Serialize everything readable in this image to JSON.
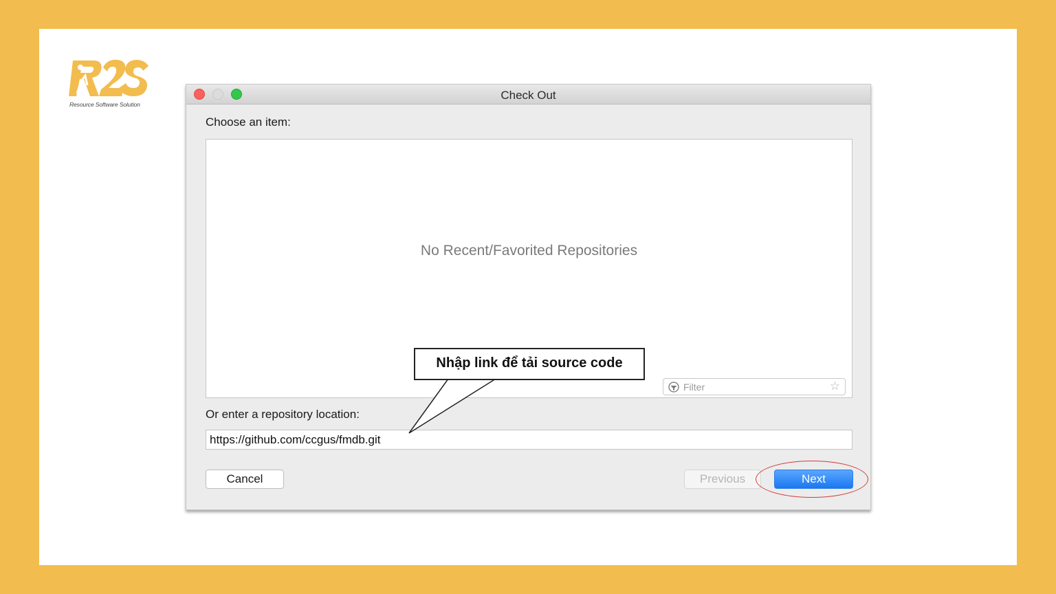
{
  "logo": {
    "tagline": "Resource Software Solution"
  },
  "window": {
    "title": "Check Out",
    "choose_label": "Choose an item:",
    "empty_message": "No Recent/Favorited Repositories",
    "filter_placeholder": "Filter",
    "location_label": "Or enter a repository location:",
    "location_value": "https://github.com/ccgus/fmdb.git",
    "buttons": {
      "cancel": "Cancel",
      "previous": "Previous",
      "next": "Next"
    }
  },
  "annotation": {
    "callout_text": "Nhập link để tải source code"
  },
  "colors": {
    "background": "#f2bc4e",
    "accent": "#1a78f2",
    "highlight": "#cf3b3b",
    "logo": "#f2bc4e"
  }
}
